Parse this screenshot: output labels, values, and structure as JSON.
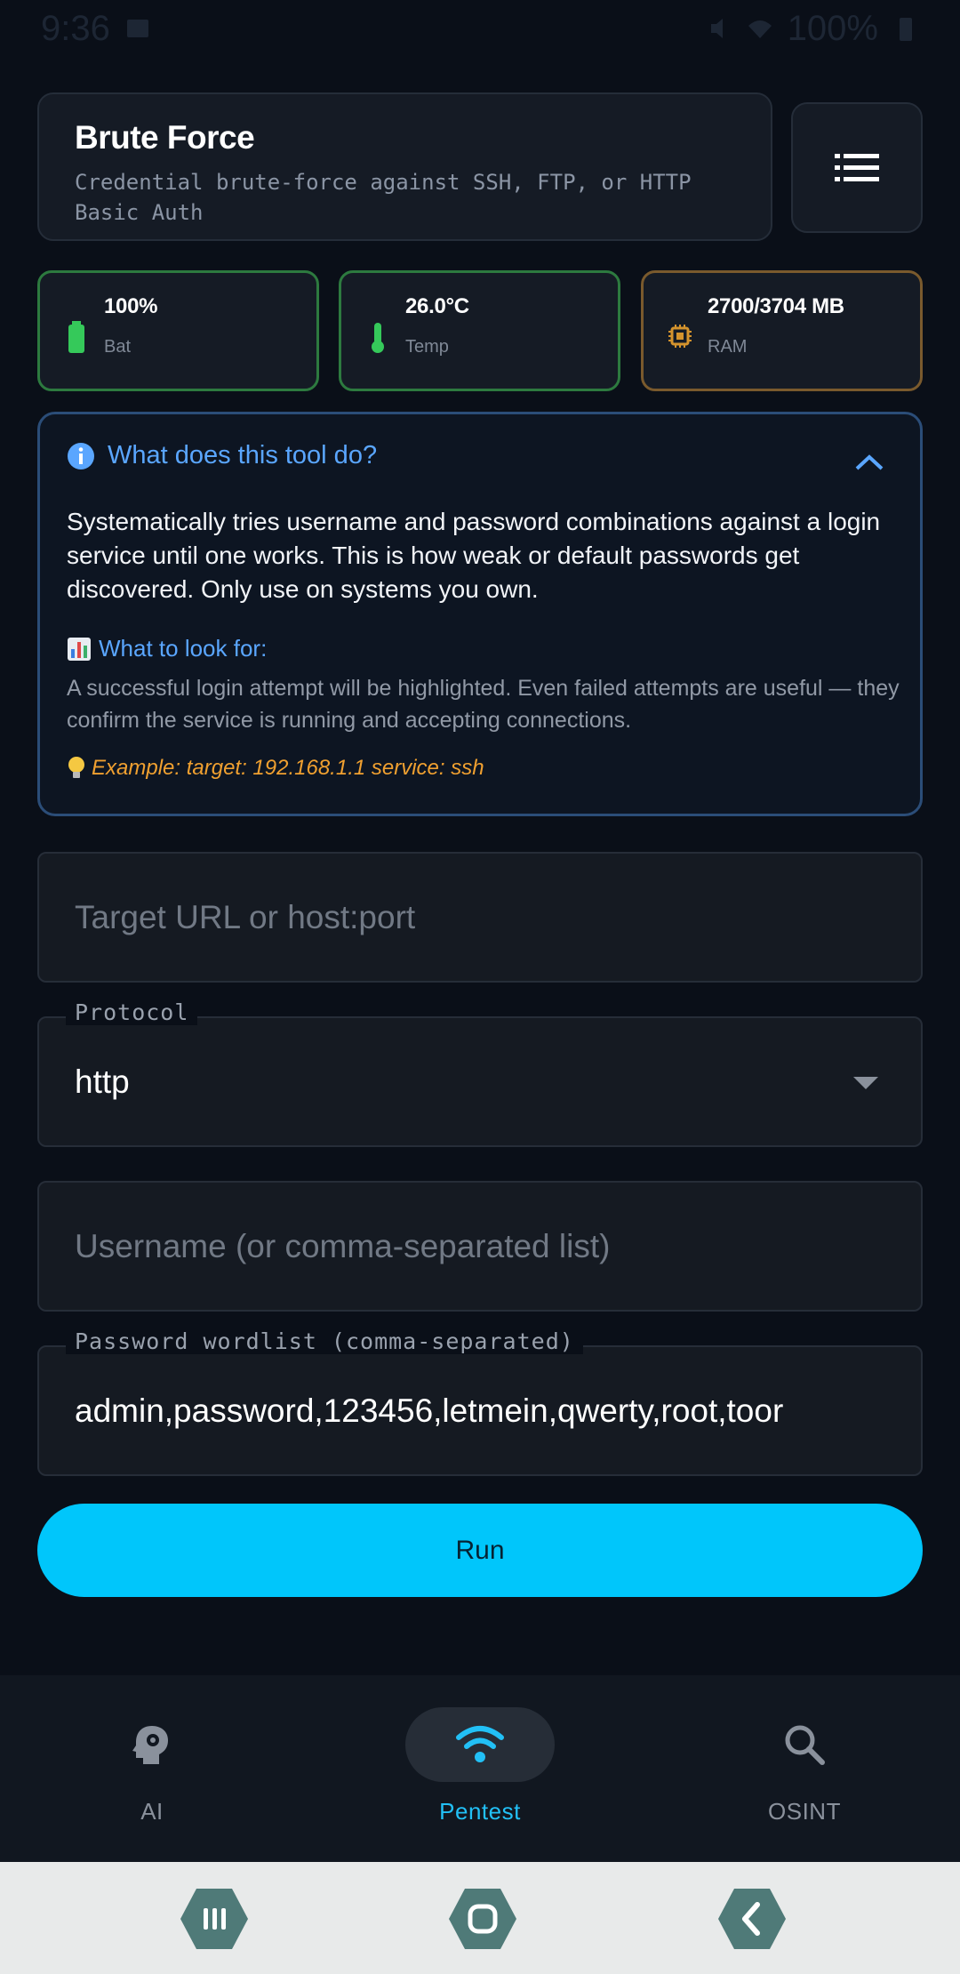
{
  "status_bar": {
    "time": "9:36",
    "battery": "100%"
  },
  "header": {
    "title": "Brute Force",
    "subtitle": "Credential brute-force against SSH, FTP, or HTTP Basic Auth"
  },
  "stats": [
    {
      "value": "100%",
      "label": "Bat",
      "icon": "battery-icon",
      "color": "#35c95a"
    },
    {
      "value": "26.0°C",
      "label": "Temp",
      "icon": "thermometer-icon",
      "color": "#35c95a"
    },
    {
      "value": "2700/3704 MB",
      "label": "RAM",
      "icon": "chip-icon",
      "color": "#d4932d"
    }
  ],
  "info": {
    "title": "What does this tool do?",
    "body": "Systematically tries username and password combinations against a login service until one works. This is how weak or default passwords get discovered. Only use on systems you own.",
    "look_title": "What to look for:",
    "look_text": "A successful login attempt will be highlighted. Even failed attempts are useful — they confirm the service is running and accepting connections.",
    "example": "Example: target: 192.168.1.1  service: ssh"
  },
  "form": {
    "target_placeholder": "Target URL or host:port",
    "protocol_label": "Protocol",
    "protocol_value": "http",
    "username_placeholder": "Username (or comma-separated list)",
    "password_label": "Password wordlist (comma-separated)",
    "password_value": "admin,password,123456,letmein,qwerty,root,toor",
    "run_label": "Run"
  },
  "bottom_nav": [
    {
      "label": "AI",
      "icon": "brain-gear-icon",
      "active": false
    },
    {
      "label": "Pentest",
      "icon": "wifi-icon",
      "active": true
    },
    {
      "label": "OSINT",
      "icon": "search-icon",
      "active": false
    }
  ],
  "colors": {
    "accent": "#00c6fb",
    "info_border": "#2b4d78",
    "link": "#5aa6ff",
    "example": "#f0a030"
  }
}
